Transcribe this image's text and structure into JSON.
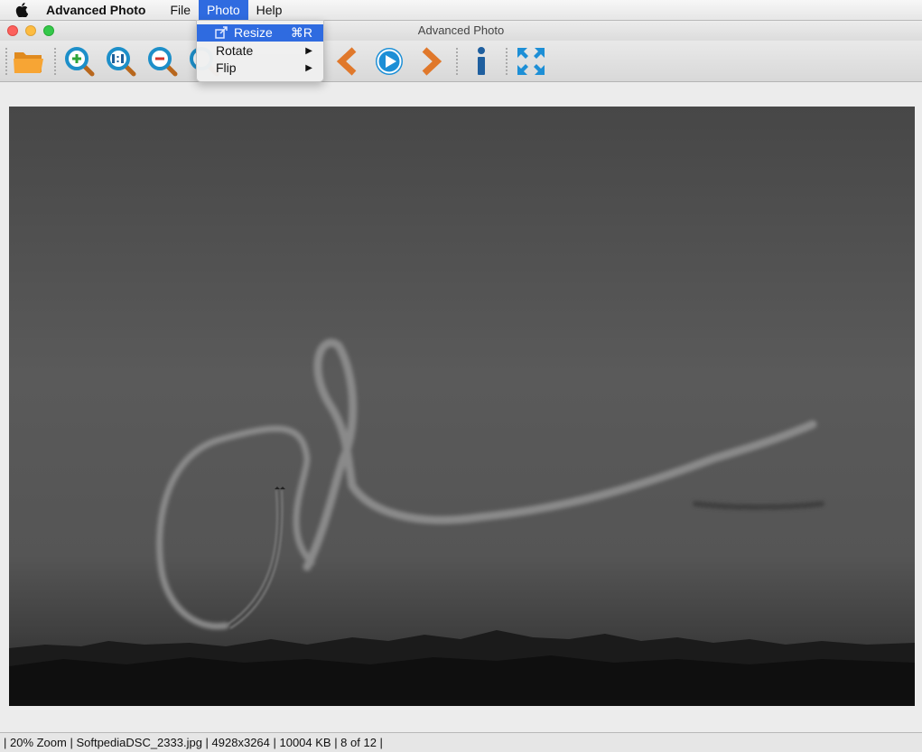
{
  "menubar": {
    "app_name": "Advanced Photo",
    "items": [
      "File",
      "Photo",
      "Help"
    ]
  },
  "window": {
    "title": "Advanced Photo"
  },
  "toolbar": {
    "buttons": [
      "open-folder",
      "zoom-in",
      "zoom-actual-size",
      "zoom-out",
      "zoom-fit",
      "previous",
      "play-slideshow",
      "next",
      "info",
      "fullscreen"
    ]
  },
  "photo_menu": {
    "items": [
      {
        "label": "Resize",
        "shortcut": "⌘R",
        "selected": true
      },
      {
        "label": "Rotate",
        "submenu": true
      },
      {
        "label": "Flip",
        "submenu": true
      }
    ]
  },
  "status": {
    "text": "| 20% Zoom | SoftpediaDSC_2333.jpg | 4928x3264 | 10004 KB | 8 of 12 |"
  },
  "colors": {
    "accent": "#2f6be0",
    "zoom_icon": "#1d8fc9",
    "nav_arrow": "#e0782b",
    "play": "#1d8fd6"
  }
}
